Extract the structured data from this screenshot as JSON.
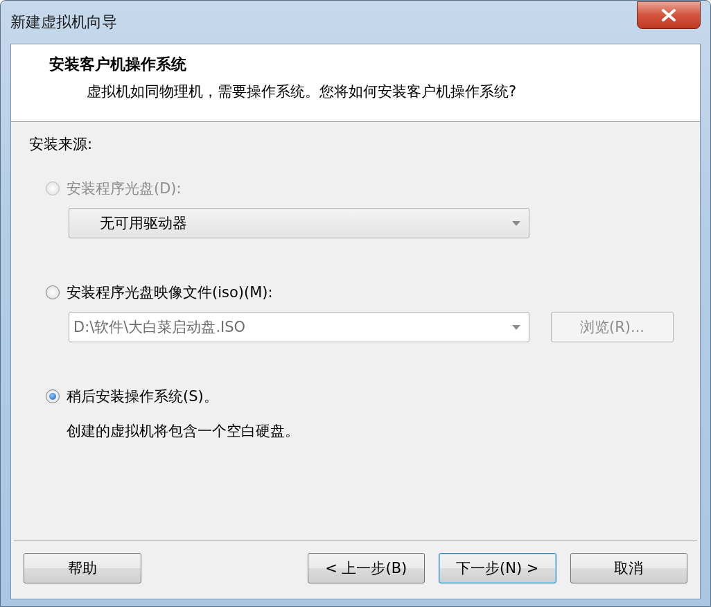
{
  "window": {
    "title": "新建虚拟机向导"
  },
  "header": {
    "title": "安装客户机操作系统",
    "subtitle": "虚拟机如同物理机，需要操作系统。您将如何安装客户机操作系统?"
  },
  "source_label": "安装来源:",
  "options": [
    {
      "kind": "disc",
      "label": "安装程序光盘(D):",
      "selected": false,
      "disabled": true,
      "dropdown": {
        "value": "无可用驱动器",
        "disabled": false
      }
    },
    {
      "kind": "iso",
      "label": "安装程序光盘映像文件(iso)(M):",
      "selected": false,
      "disabled": false,
      "dropdown": {
        "value": "D:\\软件\\大白菜启动盘.ISO",
        "disabled": true
      },
      "browse": {
        "label": "浏览(R)...",
        "disabled": true
      }
    },
    {
      "kind": "later",
      "label": "稍后安装操作系统(S)。",
      "selected": true,
      "disabled": false,
      "note": "创建的虚拟机将包含一个空白硬盘。"
    }
  ],
  "buttons": [
    {
      "label": "帮助",
      "default": false
    },
    {
      "label": "< 上一步(B)",
      "default": false
    },
    {
      "label": "下一步(N) >",
      "default": true
    },
    {
      "label": "取消",
      "default": false
    }
  ]
}
